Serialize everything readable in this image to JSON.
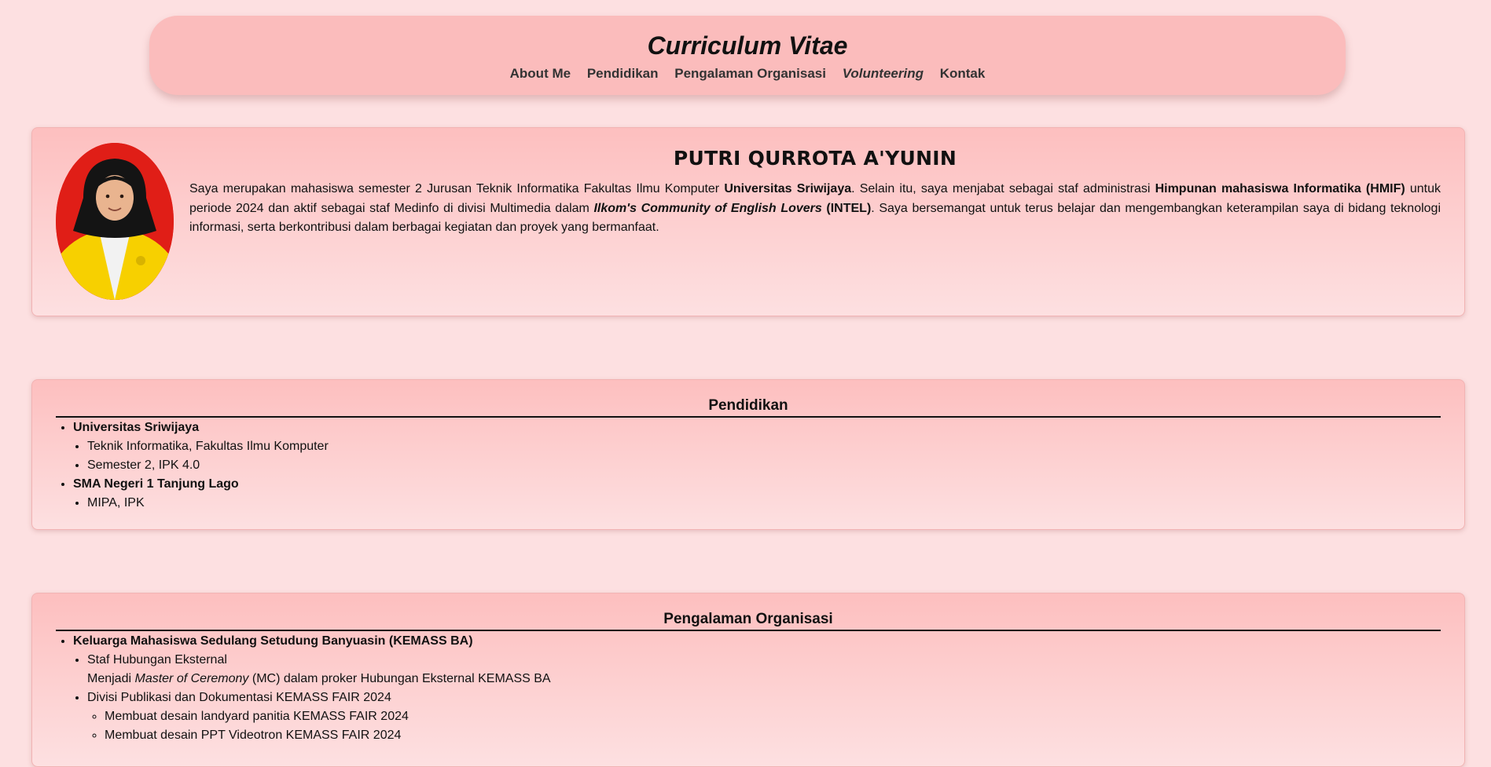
{
  "header": {
    "title": "Curriculum Vitae",
    "nav": [
      "About Me",
      "Pendidikan",
      "Pengalaman Organisasi",
      "Volunteering",
      "Kontak"
    ]
  },
  "about": {
    "name": "PUTRI QURROTA A'YUNIN",
    "bio": {
      "p1": "Saya merupakan mahasiswa semester 2 Jurusan Teknik Informatika Fakultas Ilmu Komputer ",
      "b1": "Universitas Sriwijaya",
      "p2": ". Selain itu, saya menjabat sebagai staf administrasi ",
      "b2": "Himpunan mahasiswa Informatika (HMIF)",
      "p3": " untuk periode 2024 dan aktif sebagai staf Medinfo di divisi Multimedia dalam ",
      "bi3": "Ilkom's Community of English Lovers",
      "b3": " (INTEL)",
      "p4": ". Saya bersemangat untuk terus belajar dan mengembangkan keterampilan saya di bidang teknologi informasi, serta berkontribusi dalam berbagai kegiatan dan proyek yang bermanfaat."
    }
  },
  "education": {
    "title": "Pendidikan",
    "items": [
      {
        "name": "Universitas Sriwijaya",
        "details": [
          "Teknik Informatika, Fakultas Ilmu Komputer",
          "Semester 2, IPK 4.0"
        ]
      },
      {
        "name": "SMA Negeri 1 Tanjung Lago",
        "details": [
          "MIPA, IPK"
        ]
      }
    ]
  },
  "organization": {
    "title": "Pengalaman Organisasi",
    "items": [
      {
        "name": "Keluarga Mahasiswa Sedulang Setudung Banyuasin (KEMASS BA)",
        "role1": "Staf Hubungan Eksternal",
        "role1_desc_a": "Menjadi ",
        "role1_desc_i": "Master of Ceremony",
        "role1_desc_b": " (MC) dalam proker Hubungan Eksternal KEMASS BA",
        "role2": "Divisi Publikasi dan Dokumentasi KEMASS FAIR 2024",
        "role2_items": [
          "Membuat desain landyard panitia KEMASS FAIR 2024",
          "Membuat desain PPT Videotron KEMASS FAIR 2024"
        ]
      }
    ]
  }
}
